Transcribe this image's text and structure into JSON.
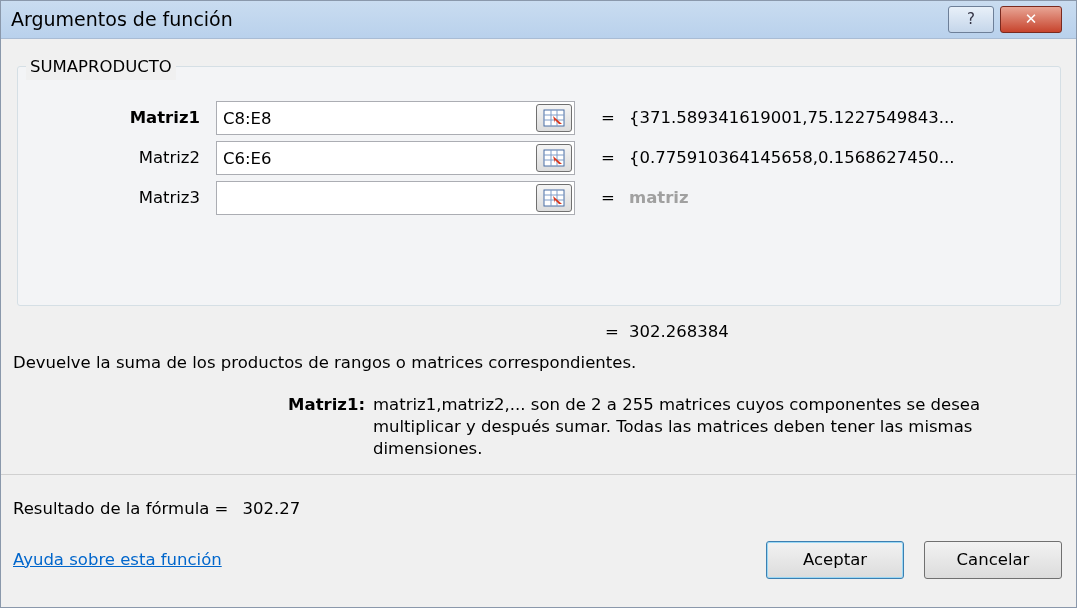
{
  "window": {
    "title": "Argumentos de función",
    "help_button": "?",
    "close_button": "✕"
  },
  "function": {
    "name": "SUMAPRODUCTO",
    "arguments": [
      {
        "label": "Matriz1",
        "selected": true,
        "value": "C8:E8",
        "equals": "=",
        "result": "{371.589341619001,75.1227549843...",
        "hint": false
      },
      {
        "label": "Matriz2",
        "selected": false,
        "value": "C6:E6",
        "equals": "=",
        "result": "{0.775910364145658,0.1568627450...",
        "hint": false
      },
      {
        "label": "Matriz3",
        "selected": false,
        "equals": "=",
        "result": "matriz",
        "hint": true
      }
    ]
  },
  "overall_result": {
    "equals": "=",
    "value": "302.268384"
  },
  "description": "Devuelve la suma de los productos de rangos o matrices correspondientes.",
  "argument_help": {
    "label": "Matriz1:",
    "text": "matriz1,matriz2,... son de 2 a 255 matrices cuyos componentes se desea multiplicar y después sumar. Todas las matrices deben tener las mismas dimensiones."
  },
  "formula_result": {
    "label": "Resultado de la fórmula =",
    "value": "302.27"
  },
  "help_link": "Ayuda sobre esta función",
  "buttons": [
    {
      "label": "Aceptar",
      "default": true
    },
    {
      "label": "Cancelar",
      "default": false
    }
  ]
}
